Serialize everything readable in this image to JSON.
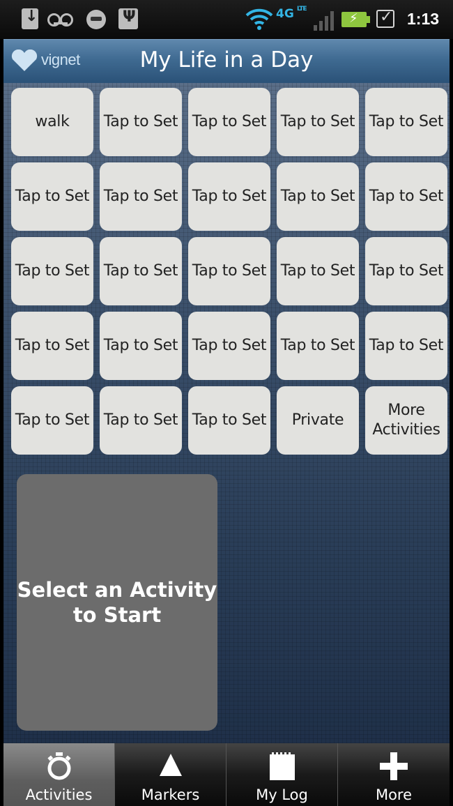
{
  "status_bar": {
    "time": "1:13",
    "network": "4G",
    "network_sub": "LTE"
  },
  "app": {
    "logo_text": "vignet",
    "title": "My Life in a Day"
  },
  "tiles": [
    "walk",
    "Tap to Set",
    "Tap to Set",
    "Tap to Set",
    "Tap to Set",
    "Tap to Set",
    "Tap to Set",
    "Tap to Set",
    "Tap to Set",
    "Tap to Set",
    "Tap to Set",
    "Tap to Set",
    "Tap to Set",
    "Tap to Set",
    "Tap to Set",
    "Tap to Set",
    "Tap to Set",
    "Tap to Set",
    "Tap to Set",
    "Tap to Set",
    "Tap to Set",
    "Tap to Set",
    "Tap to Set",
    "Private",
    "More\nActivities"
  ],
  "start_panel": {
    "text": "Select an Activity\nto Start"
  },
  "tabs": [
    {
      "label": "Activities",
      "icon": "stopwatch-icon",
      "active": true
    },
    {
      "label": "Markers",
      "icon": "triangle-marker-icon",
      "active": false
    },
    {
      "label": "My Log",
      "icon": "notepad-icon",
      "active": false
    },
    {
      "label": "More",
      "icon": "plus-icon",
      "active": false
    }
  ],
  "colors": {
    "accent": "#33b5e5",
    "battery": "#8ec63f",
    "tile": "#e2e2df",
    "panel": "#6c6c6c"
  }
}
